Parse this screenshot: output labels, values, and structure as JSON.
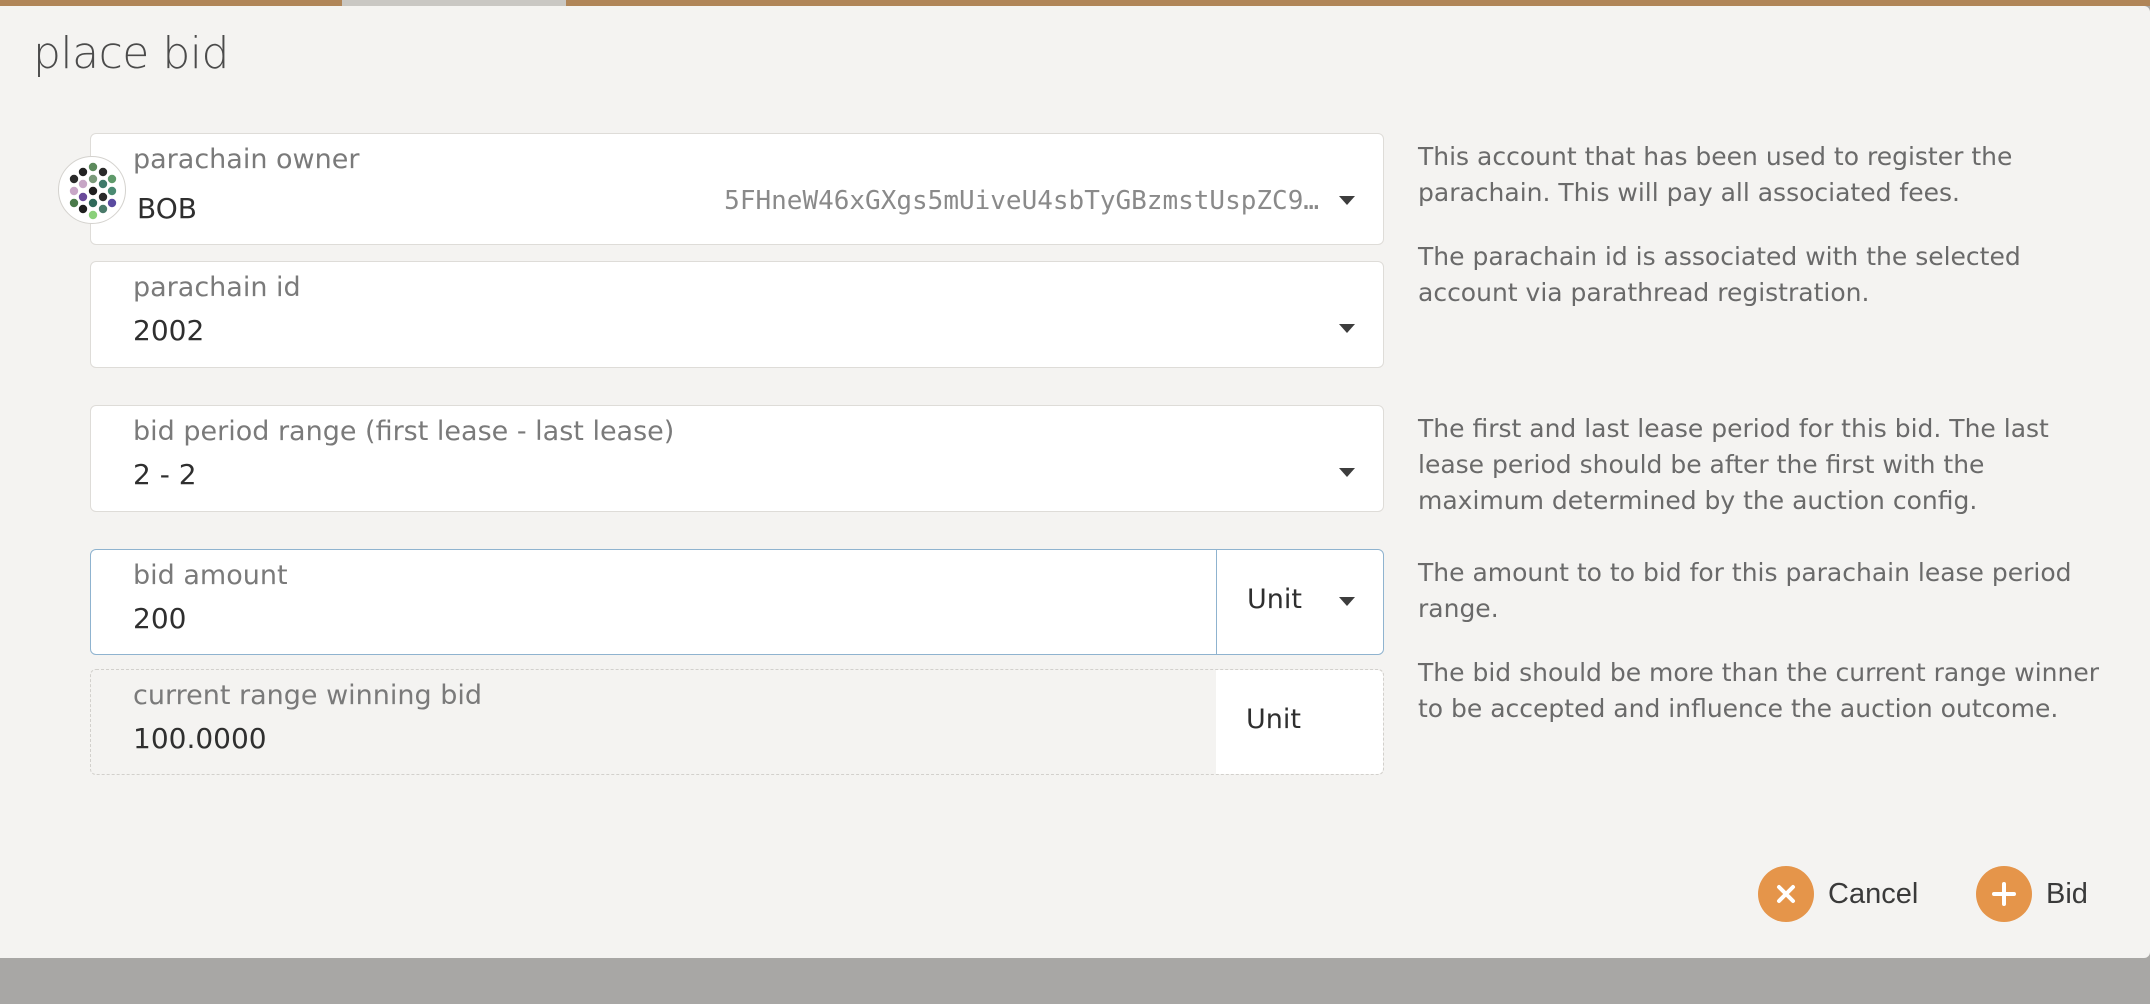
{
  "modal": {
    "title": "place bid"
  },
  "owner": {
    "label": "parachain owner",
    "name": "BOB",
    "address": "5FHneW46xGXgs5mUiveU4sbTyGBzmstUspZC9…",
    "help": "This account that has been used to register the parachain. This will pay all associated fees."
  },
  "parachain_id": {
    "label": "parachain id",
    "value": "2002",
    "help": "The parachain id is associated with the selected account via parathread registration."
  },
  "bid_period": {
    "label": "bid period range (first lease - last lease)",
    "value": "2 - 2",
    "help": "The first and last lease period for this bid. The last lease period should be after the first with the maximum determined by the auction config."
  },
  "bid_amount": {
    "label": "bid amount",
    "value": "200",
    "unit": "Unit",
    "help": "The amount to to bid for this parachain lease period range."
  },
  "winning_bid": {
    "label": "current range winning bid",
    "value": "100.0000",
    "unit": "Unit",
    "help": "The bid should be more than the current range winner to be accepted and influence the auction outcome."
  },
  "actions": {
    "cancel_label": "Cancel",
    "bid_label": "Bid"
  },
  "colors": {
    "accent": "#e5954a",
    "topbar": "#b08558",
    "focus_border": "#8fb3cf"
  },
  "icons": {
    "owner_avatar": "identicon",
    "dropdown": "caret-down-icon",
    "cancel": "close-icon",
    "bid": "plus-icon"
  }
}
